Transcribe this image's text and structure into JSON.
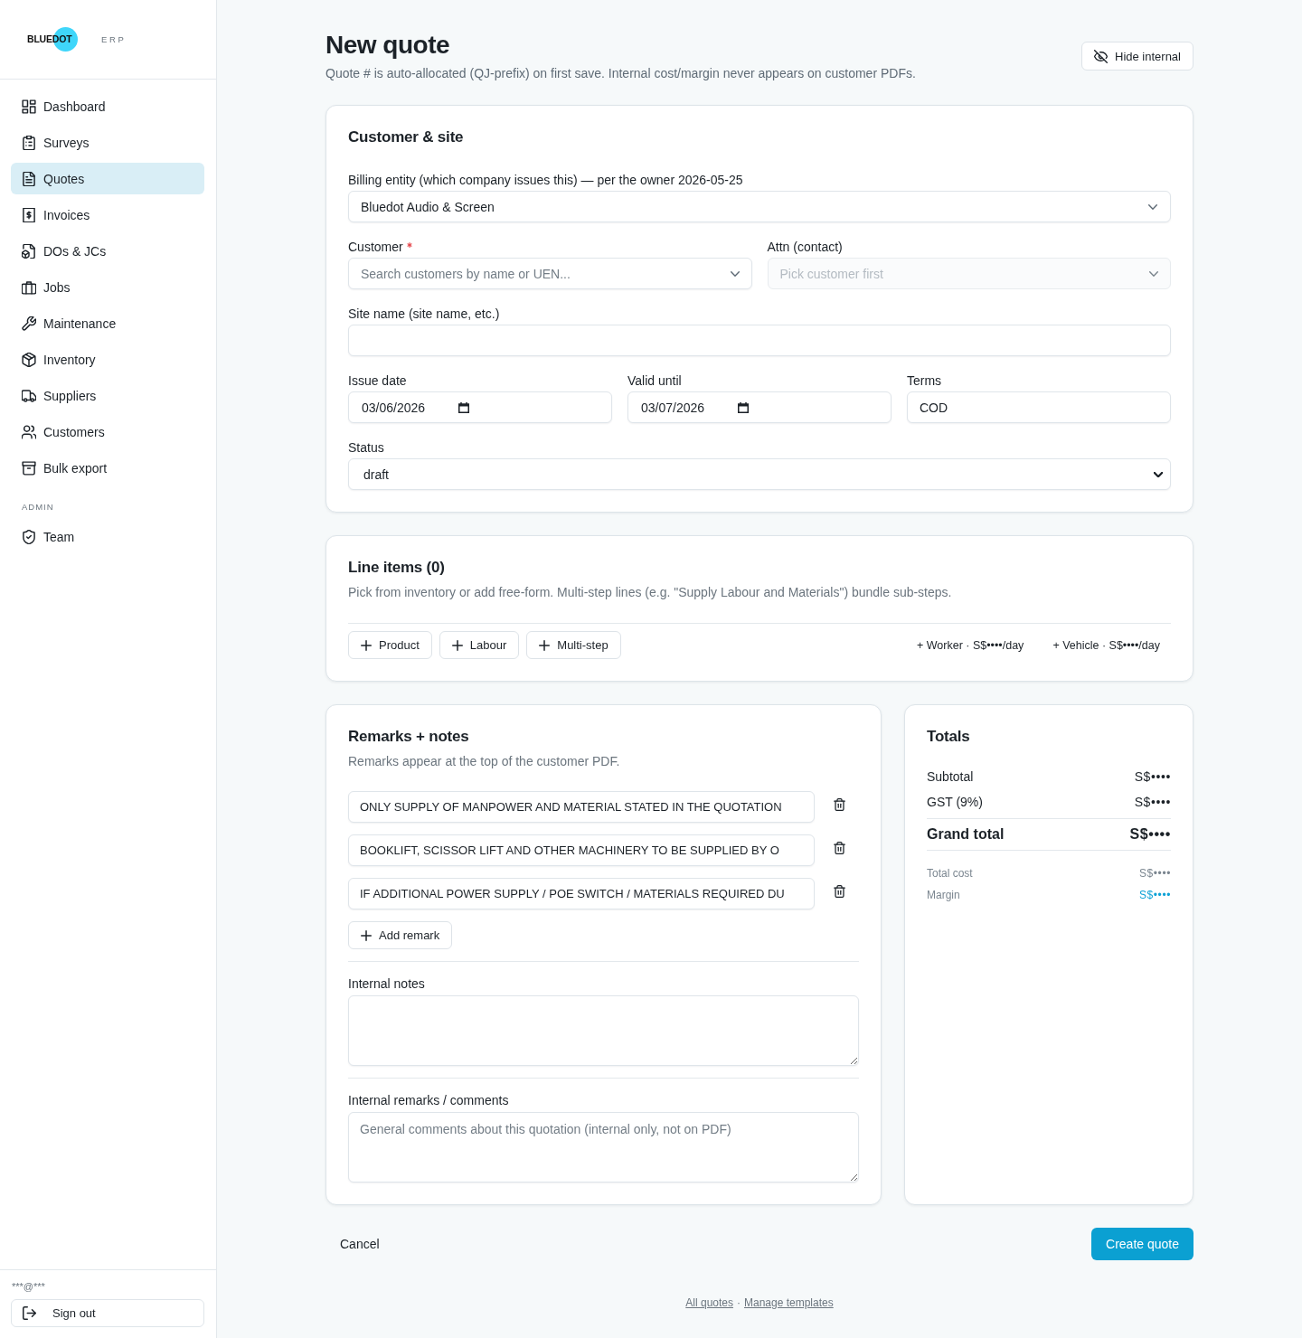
{
  "sidebar": {
    "logo": {
      "wordmark": "BLUEDOT",
      "product": "ERP"
    },
    "nav": [
      {
        "label": "Dashboard",
        "selected": false
      },
      {
        "label": "Surveys",
        "selected": false
      },
      {
        "label": "Quotes",
        "selected": true
      },
      {
        "label": "Invoices",
        "selected": false
      },
      {
        "label": "DOs & JCs",
        "selected": false
      },
      {
        "label": "Jobs",
        "selected": false
      },
      {
        "label": "Maintenance",
        "selected": false
      },
      {
        "label": "Inventory",
        "selected": false
      },
      {
        "label": "Suppliers",
        "selected": false
      },
      {
        "label": "Customers",
        "selected": false
      },
      {
        "label": "Bulk export",
        "selected": false
      }
    ],
    "admin": {
      "heading": "ADMIN",
      "nav": [
        {
          "label": "Team",
          "selected": false
        }
      ]
    },
    "user": "***@***",
    "sign_out": "Sign out"
  },
  "header": {
    "title": "New quote",
    "subtitle": "Quote # is auto-allocated (QJ-prefix) on first save. Internal cost/margin never appears on customer PDFs.",
    "hide_internal": "Hide internal"
  },
  "customer_site": {
    "title": "Customer & site",
    "billing_entity": {
      "label": "Billing entity (which company issues this) — per the owner 2026-05-25",
      "value": "Bluedot Audio & Screen"
    },
    "customer": {
      "label": "Customer",
      "required": true,
      "disabled": false,
      "placeholder": "Search customers by name or UEN..."
    },
    "attn": {
      "label": "Attn (contact)",
      "disabled": true,
      "placeholder": "Pick customer first"
    },
    "site_name": {
      "label": "Site name (site name, etc.)"
    },
    "issue_date": {
      "label": "Issue date",
      "value": "03/06/2026"
    },
    "valid_until": {
      "label": "Valid until",
      "value": "03/07/2026"
    },
    "terms": {
      "label": "Terms",
      "value": "COD"
    },
    "status": {
      "label": "Status",
      "value": "draft"
    }
  },
  "line_items": {
    "title": "Line items (0)",
    "description": "Pick from inventory or add free-form. Multi-step lines (e.g. \"Supply Labour and Materials\") bundle sub-steps.",
    "add_buttons": [
      "Product",
      "Labour",
      "Multi-step"
    ],
    "quick_adds": [
      "+ Worker · S$••••/day",
      "+ Vehicle · S$••••/day"
    ]
  },
  "remarks": {
    "title": "Remarks + notes",
    "description": "Remarks appear at the top of the customer PDF.",
    "items": [
      "ONLY SUPPLY OF MANPOWER AND MATERIAL STATED IN THE QUOTATION",
      "BOOKLIFT, SCISSOR LIFT AND OTHER MACHINERY TO BE SUPPLIED BY O",
      "IF ADDITIONAL POWER SUPPLY / POE SWITCH / MATERIALS REQUIRED DU"
    ],
    "add_remark": "Add remark",
    "internal_notes": {
      "label": "Internal notes"
    },
    "internal_remarks": {
      "label": "Internal remarks / comments",
      "placeholder": "General comments about this quotation (internal only, not on PDF)"
    }
  },
  "totals": {
    "title": "Totals",
    "rows": [
      {
        "kind": "line",
        "label": "Subtotal",
        "value": "S$••••"
      },
      {
        "kind": "line",
        "label": "GST (9%)",
        "value": "S$••••"
      },
      {
        "kind": "grand",
        "label": "Grand total",
        "value": "S$••••"
      },
      {
        "kind": "internal",
        "label": "Total cost",
        "value": "S$••••"
      },
      {
        "kind": "margin",
        "label": "Margin",
        "value": "S$••••"
      }
    ]
  },
  "footer": {
    "cancel": "Cancel",
    "submit": "Create quote",
    "links": [
      "All quotes",
      "Manage templates"
    ],
    "link_separator": "·"
  }
}
